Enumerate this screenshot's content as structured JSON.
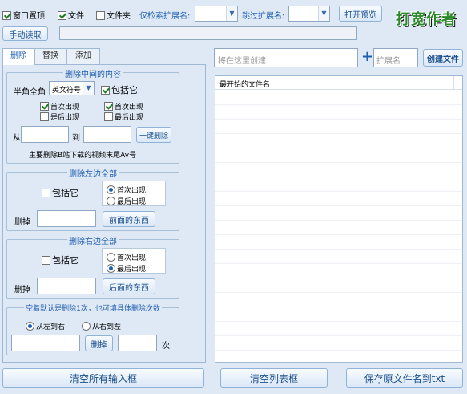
{
  "toolbar": {
    "window_topmost": "窗口置顶",
    "files": "文件",
    "folders": "文件夹",
    "only_ext_label": "仅检索扩展名:",
    "skip_ext_label": "跳过扩展名:",
    "open_preview": "打开预览",
    "manual_read": "手动读取",
    "logo_text": "打宽作者"
  },
  "tabs": [
    "删除",
    "替换",
    "添加"
  ],
  "delete_middle": {
    "legend": "删除中间的内容",
    "width_label": "半角全角",
    "width_value": "英文符号",
    "include_it": "包括它",
    "left_first": "首次出现",
    "left_last": "是后出现",
    "right_first": "首次出现",
    "right_last": "最后出现",
    "from": "从",
    "to": "到",
    "one_click_delete": "一键删除",
    "tip": "主要删除B站下载的视频末尾Av号"
  },
  "delete_left": {
    "legend": "删除左边全部",
    "include_it": "包括它",
    "first": "首次出现",
    "last": "最后出现",
    "delete_label": "删掉",
    "button": "前面的东西"
  },
  "delete_right": {
    "legend": "删除右边全部",
    "include_it": "包括它",
    "first": "首次出现",
    "last": "最后出现",
    "delete_label": "删掉",
    "button": "后面的东西"
  },
  "delete_count": {
    "legend": "空着默认是删除1次，也可填具体删除次数",
    "left_to_right": "从左到右",
    "right_to_left": "从右到左",
    "delete_button": "删掉",
    "times": "次"
  },
  "create": {
    "placeholder": "将在这里创建",
    "plus": "+",
    "ext_placeholder": "扩展名",
    "button": "创建文件"
  },
  "list": {
    "header": "最开始的文件名"
  },
  "bottom": {
    "clear_inputs": "清空所有输入框",
    "clear_list": "清空列表框",
    "save_txt": "保存原文件名到txt"
  }
}
